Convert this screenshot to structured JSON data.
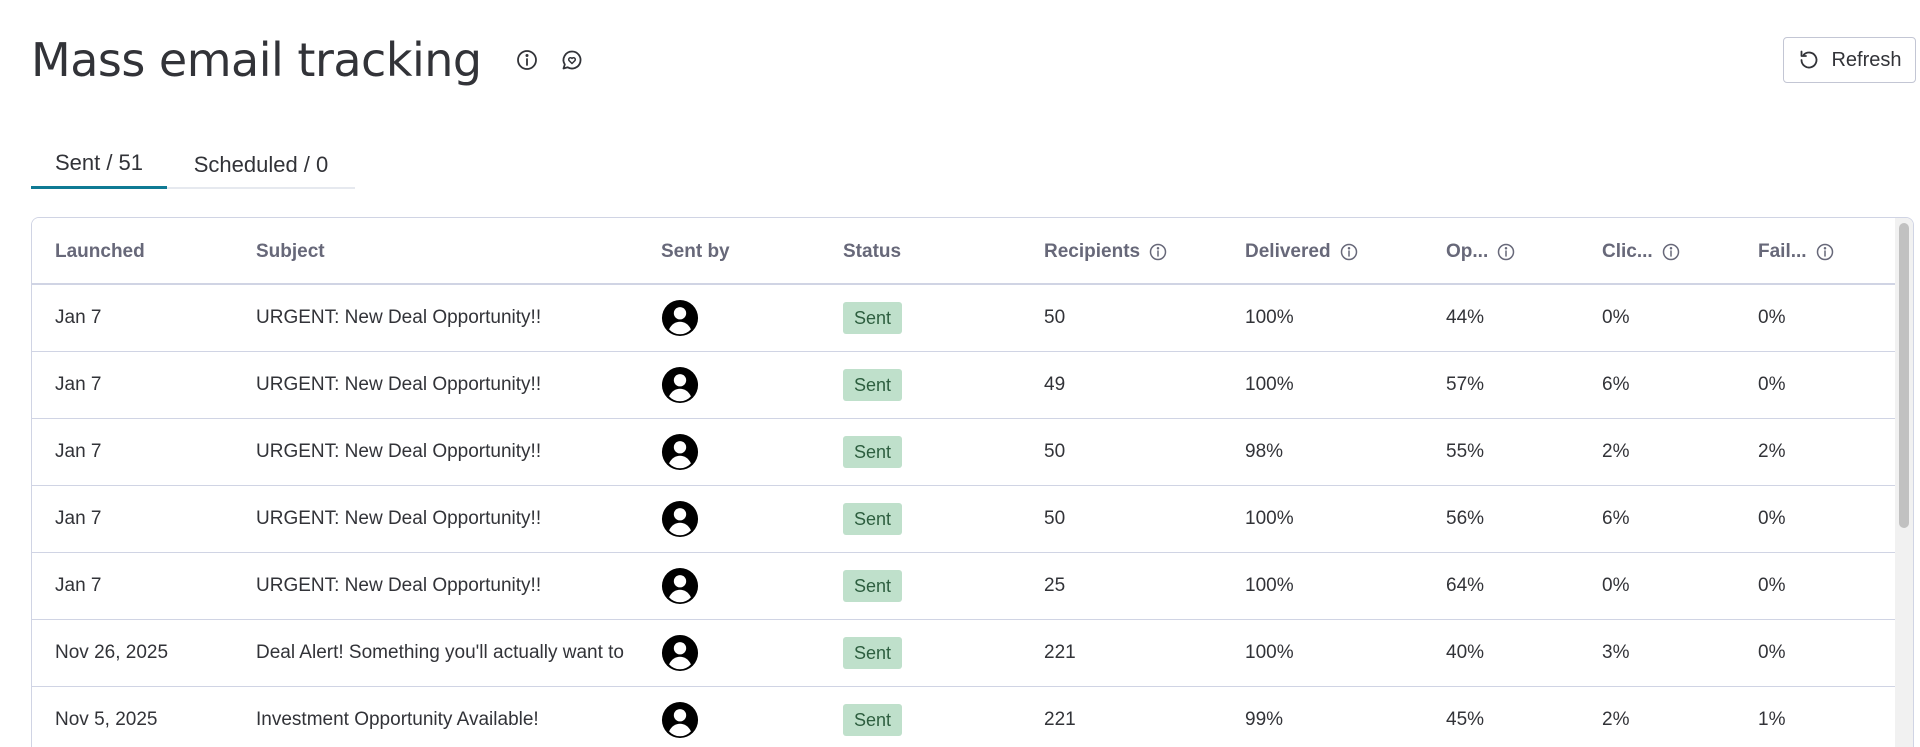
{
  "header": {
    "title": "Mass email tracking",
    "refresh_label": "Refresh"
  },
  "tabs": [
    {
      "label": "Sent / 51"
    },
    {
      "label": "Scheduled / 0"
    }
  ],
  "table": {
    "columns": [
      {
        "label": "Launched",
        "info": false
      },
      {
        "label": "Subject",
        "info": false
      },
      {
        "label": "Sent by",
        "info": false
      },
      {
        "label": "Status",
        "info": false
      },
      {
        "label": "Recipients",
        "info": true
      },
      {
        "label": "Delivered",
        "info": true
      },
      {
        "label": "Op...",
        "info": true
      },
      {
        "label": "Clic...",
        "info": true
      },
      {
        "label": "Fail...",
        "info": true
      }
    ],
    "rows": [
      {
        "launched": "Jan 7",
        "subject": "URGENT: New Deal Opportunity!!",
        "status": "Sent",
        "recipients": "50",
        "delivered": "100%",
        "opened": "44%",
        "clicked": "0%",
        "failed": "0%"
      },
      {
        "launched": "Jan 7",
        "subject": "URGENT: New Deal Opportunity!!",
        "status": "Sent",
        "recipients": "49",
        "delivered": "100%",
        "opened": "57%",
        "clicked": "6%",
        "failed": "0%"
      },
      {
        "launched": "Jan 7",
        "subject": "URGENT: New Deal Opportunity!!",
        "status": "Sent",
        "recipients": "50",
        "delivered": "98%",
        "opened": "55%",
        "clicked": "2%",
        "failed": "2%"
      },
      {
        "launched": "Jan 7",
        "subject": "URGENT: New Deal Opportunity!!",
        "status": "Sent",
        "recipients": "50",
        "delivered": "100%",
        "opened": "56%",
        "clicked": "6%",
        "failed": "0%"
      },
      {
        "launched": "Jan 7",
        "subject": "URGENT: New Deal Opportunity!!",
        "status": "Sent",
        "recipients": "25",
        "delivered": "100%",
        "opened": "64%",
        "clicked": "0%",
        "failed": "0%"
      },
      {
        "launched": "Nov 26, 2025",
        "subject": "Deal Alert! Something you'll actually want to",
        "status": "Sent",
        "recipients": "221",
        "delivered": "100%",
        "opened": "40%",
        "clicked": "3%",
        "failed": "0%"
      },
      {
        "launched": "Nov 5, 2025",
        "subject": "Investment Opportunity Available!",
        "status": "Sent",
        "recipients": "221",
        "delivered": "99%",
        "opened": "45%",
        "clicked": "2%",
        "failed": "1%"
      }
    ]
  },
  "icons": {
    "info": "info-icon",
    "feedback": "feedback-icon",
    "refresh": "refresh-icon",
    "avatar": "user-avatar-icon"
  },
  "colors": {
    "tab_active": "#0f7a94",
    "status_sent_bg": "#bfe0cb",
    "status_sent_text": "#2d5e3f",
    "border": "#d0d4e4"
  }
}
